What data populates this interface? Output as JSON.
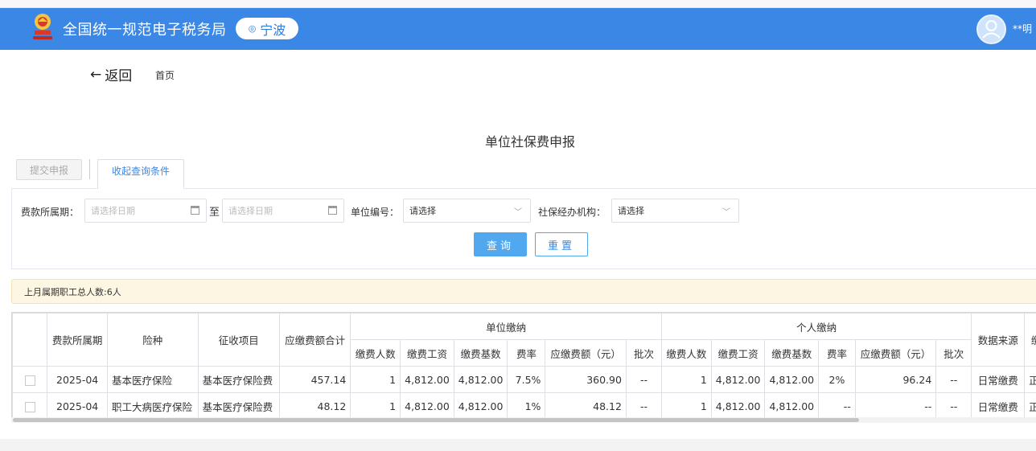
{
  "header": {
    "site_title": "全国统一规范电子税务局",
    "city": "宁波",
    "user_name": "**明",
    "brand_color": "#3a87e5"
  },
  "nav": {
    "back_label": "返回",
    "home_label": "首页"
  },
  "page_title": "单位社保费申报",
  "tabs": {
    "submit_label": "提交申报",
    "collapse_label": "收起查询条件"
  },
  "filters": {
    "period_label": "费款所属期：",
    "date_start_placeholder": "请选择日期",
    "to_label": "至",
    "date_end_placeholder": "请选择日期",
    "unit_code_label": "单位编号：",
    "unit_code_value": "请选择",
    "agency_label": "社保经办机构：",
    "agency_value": "请选择",
    "query_label": "查询",
    "reset_label": "重置"
  },
  "notice_text": "上月属期职工总人数:6人",
  "table": {
    "headers": {
      "period": "费款所属期",
      "insurance_type": "险种",
      "collection_item": "征收项目",
      "total_due": "应缴费额合计",
      "unit_group": "单位缴纳",
      "personal_group": "个人缴纳",
      "data_source": "数据来源",
      "status_partial": "缴",
      "sub": {
        "headcount": "缴费人数",
        "wage": "缴费工资",
        "base": "缴费基数",
        "rate": "费率",
        "amount": "应缴费额（元）",
        "batch": "批次"
      }
    },
    "rows": [
      {
        "period": "2025-04",
        "insurance_type": "基本医疗保险",
        "collection_item": "基本医疗保险费",
        "total_due": "457.14",
        "unit": {
          "headcount": "1",
          "wage": "4,812.00",
          "base": "4,812.00",
          "rate": "7.5%",
          "amount": "360.90",
          "batch": "--"
        },
        "personal": {
          "headcount": "1",
          "wage": "4,812.00",
          "base": "4,812.00",
          "rate": "2%",
          "amount": "96.24",
          "batch": "--"
        },
        "data_source": "日常缴费",
        "status_partial": "正"
      },
      {
        "period": "2025-04",
        "insurance_type": "职工大病医疗保险",
        "collection_item": "基本医疗保险费",
        "total_due": "48.12",
        "unit": {
          "headcount": "1",
          "wage": "4,812.00",
          "base": "4,812.00",
          "rate": "1%",
          "amount": "48.12",
          "batch": "--"
        },
        "personal": {
          "headcount": "1",
          "wage": "4,812.00",
          "base": "4,812.00",
          "rate": "--",
          "amount": "--",
          "batch": "--"
        },
        "data_source": "日常缴费",
        "status_partial": "正"
      }
    ]
  }
}
